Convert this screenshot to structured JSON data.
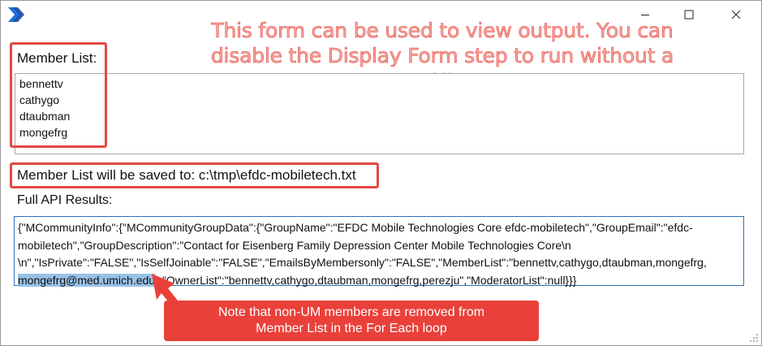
{
  "window": {
    "app_icon": "power-automate-chevron-icon",
    "controls": [
      "minimize-icon",
      "maximize-icon",
      "close-icon"
    ]
  },
  "annotation": {
    "headline_line1": "This form can be used to view output.  You can",
    "headline_line2": "disable the Display Form step to run without a UI",
    "callout_line1": "Note that non-UM members are removed from",
    "callout_line2": "Member List in the For Each loop",
    "color": "#e9413a"
  },
  "member_list": {
    "label": "Member List:",
    "items": [
      "bennettv",
      "cathygo",
      "dtaubman",
      "mongefrg"
    ]
  },
  "save_path": {
    "text": "Member List will be saved to: c:\\tmp\\efdc-mobiletech.txt"
  },
  "api_results": {
    "label": "Full API Results:",
    "line1": "{\"MCommunityInfo\":{\"MCommunityGroupData\":{\"GroupName\":\"EFDC Mobile Technologies Core efdc-mobiletech\",\"GroupEmail\":\"efdc-",
    "line2": "mobiletech\",\"GroupDescription\":\"Contact for Eisenberg Family Depression Center Mobile Technologies Core\\n",
    "line3": "\\n\",\"IsPrivate\":\"FALSE\",\"IsSelfJoinable\":\"FALSE\",\"EmailsByMembersonly\":\"FALSE\",\"MemberList\":\"bennettv,cathygo,dtaubman,mongefrg,",
    "line4_highlight": "mongefrg@med.umich.edu",
    "line4_rest": "\",\"OwnerList\":\"bennettv,cathygo,dtaubman,mongefrg,perezju\",\"ModeratorList\":null}}}"
  }
}
